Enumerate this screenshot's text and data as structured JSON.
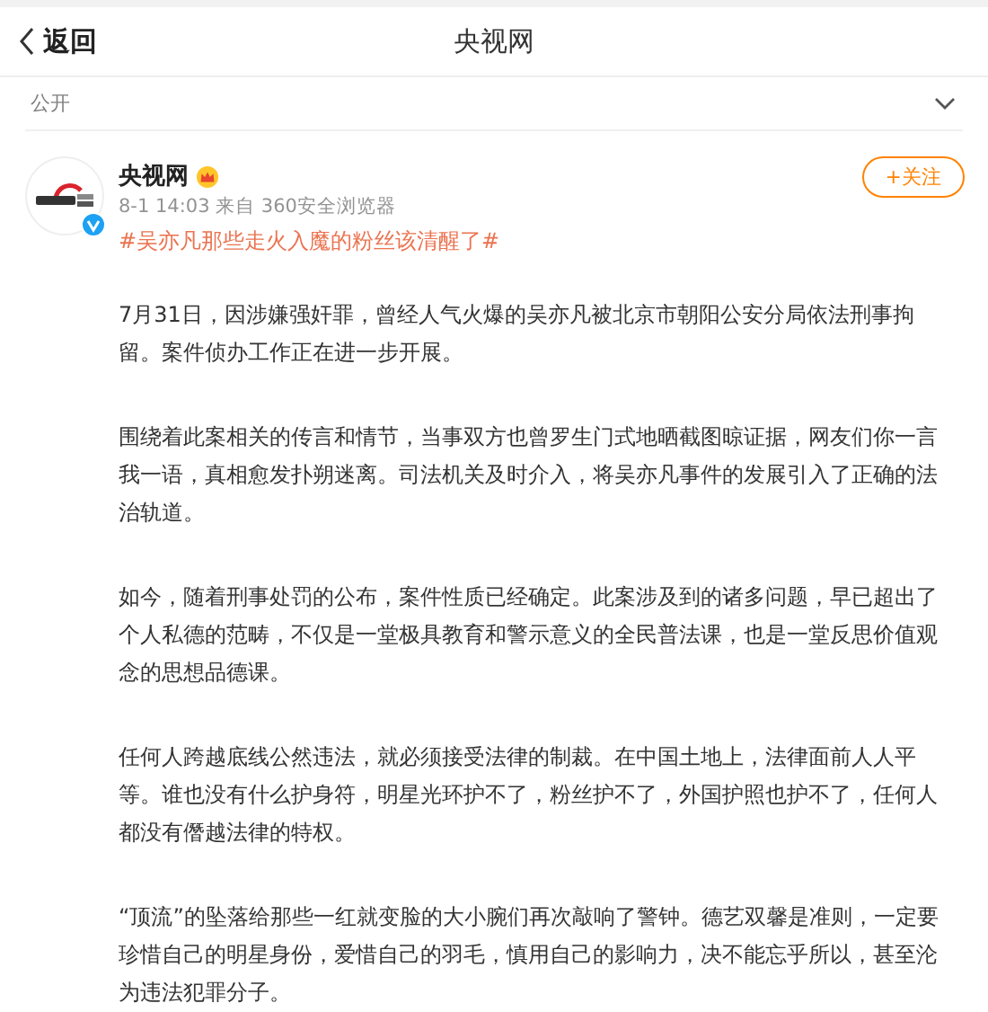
{
  "header": {
    "back_label": "返回",
    "title": "央视网"
  },
  "visibility": {
    "label": "公开",
    "expanded": false
  },
  "post": {
    "author": "央视网",
    "verified": true,
    "meta": "8-1 14:03 来自 360安全浏览器",
    "follow_label": "+关注",
    "hashtag": "#吴亦凡那些走火入魔的粉丝该清醒了#",
    "paragraphs": [
      "7月31日，因涉嫌强奸罪，曾经人气火爆的吴亦凡被北京市朝阳公安分局依法刑事拘留。案件侦办工作正在进一步开展。",
      "围绕着此案相关的传言和情节，当事双方也曾罗生门式地晒截图晾证据，网友们你一言我一语，真相愈发扑朔迷离。司法机关及时介入，将吴亦凡事件的发展引入了正确的法治轨道。",
      "如今，随着刑事处罚的公布，案件性质已经确定。此案涉及到的诸多问题，早已超出了个人私德的范畴，不仅是一堂极具教育和警示意义的全民普法课，也是一堂反思价值观念的思想品德课。",
      "任何人跨越底线公然违法，就必须接受法律的制裁。在中国土地上，法律面前人人平等。谁也没有什么护身符，明星光环护不了，粉丝护不了，外国护照也护不了，任何人都没有僭越法律的特权。",
      "“顶流”的坠落给那些一红就变脸的大小腕们再次敲响了警钟。德艺双馨是准则，一定要珍惜自己的明星身份，爱惜自己的羽毛，慎用自己的影响力，决不能忘乎所以，甚至沦为违法犯罪分子。"
    ]
  }
}
